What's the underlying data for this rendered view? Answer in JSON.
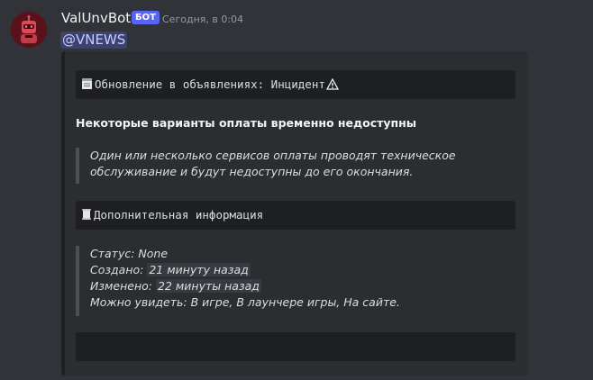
{
  "message": {
    "author": "ValUnvBot",
    "bot_tag": "БОТ",
    "timestamp": "Сегодня, в 0:04",
    "mention": "@VNEWS"
  },
  "embed": {
    "header_text": "Обновление в объявлениях: Инцидент",
    "header_icon": "notepad-icon",
    "header_suffix_icon": "warning-icon",
    "title": "Некоторые варианты оплаты временно недоступны",
    "description_lines": [
      "Один или несколько сервисов оплаты проводят техническое",
      "обслуживание и будут недоступны до его окончания."
    ],
    "info_header_text": "Дополнительная информация",
    "info_icon": "scroll-icon",
    "status_label": "Статус:",
    "status_value": "None",
    "created_label": "Создано:",
    "created_value": "21 минуту назад",
    "modified_label": "Изменено:",
    "modified_value": "22 минуты назад",
    "visible_label": "Можно увидеть:",
    "visible_value": "В игре, В лаунчере игры, На сайте."
  }
}
